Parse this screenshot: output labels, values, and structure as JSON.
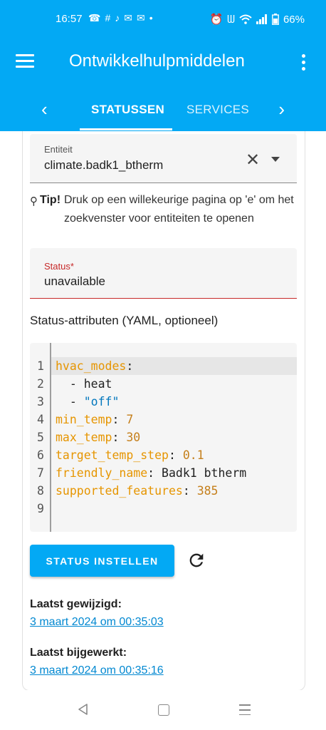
{
  "status_bar": {
    "time": "16:57",
    "notification_icons": [
      "whatsapp-icon",
      "slack-icon",
      "tiktok-icon",
      "gmail-icon",
      "mail-icon",
      "dot-icon"
    ],
    "battery": "66%"
  },
  "app_bar": {
    "title": "Ontwikkelhulpmiddelen",
    "tabs": [
      {
        "label": "STATUSSEN",
        "active": true
      },
      {
        "label": "SERVICES",
        "active": false
      }
    ],
    "accent_color": "#03a9f4"
  },
  "entity_field": {
    "label": "Entiteit",
    "value": "climate.badk1_btherm"
  },
  "tip": {
    "label": "Tip!",
    "text": "Druk op een willekeurige pagina op 'e' om het zoekvenster voor entiteiten te openen"
  },
  "status_field": {
    "label": "Status*",
    "value": "unavailable",
    "error_color": "#c62828"
  },
  "attributes": {
    "label": "Status-attributen (YAML, optioneel)",
    "lines": [
      {
        "num": "1",
        "key": "hvac_modes",
        "sep": ":",
        "val": ""
      },
      {
        "num": "2",
        "key": "",
        "sep": "  - ",
        "val": "heat"
      },
      {
        "num": "3",
        "key": "",
        "sep": "  - ",
        "val": "\"off\""
      },
      {
        "num": "4",
        "key": "min_temp",
        "sep": ": ",
        "val": "7"
      },
      {
        "num": "5",
        "key": "max_temp",
        "sep": ": ",
        "val": "30"
      },
      {
        "num": "6",
        "key": "target_temp_step",
        "sep": ": ",
        "val": "0.1"
      },
      {
        "num": "7",
        "key": "friendly_name",
        "sep": ": ",
        "val": "Badk1 btherm"
      },
      {
        "num": "8",
        "key": "supported_features",
        "sep": ": ",
        "val": "385"
      },
      {
        "num": "9",
        "key": "",
        "sep": "",
        "val": ""
      }
    ]
  },
  "actions": {
    "set_state_label": "STATUS INSTELLEN"
  },
  "last_changed": {
    "label": "Laatst gewijzigd:",
    "value": "3 maart 2024 om 00:35:03"
  },
  "last_updated": {
    "label": "Laatst bijgewerkt:",
    "value": "3 maart 2024 om 00:35:16"
  }
}
